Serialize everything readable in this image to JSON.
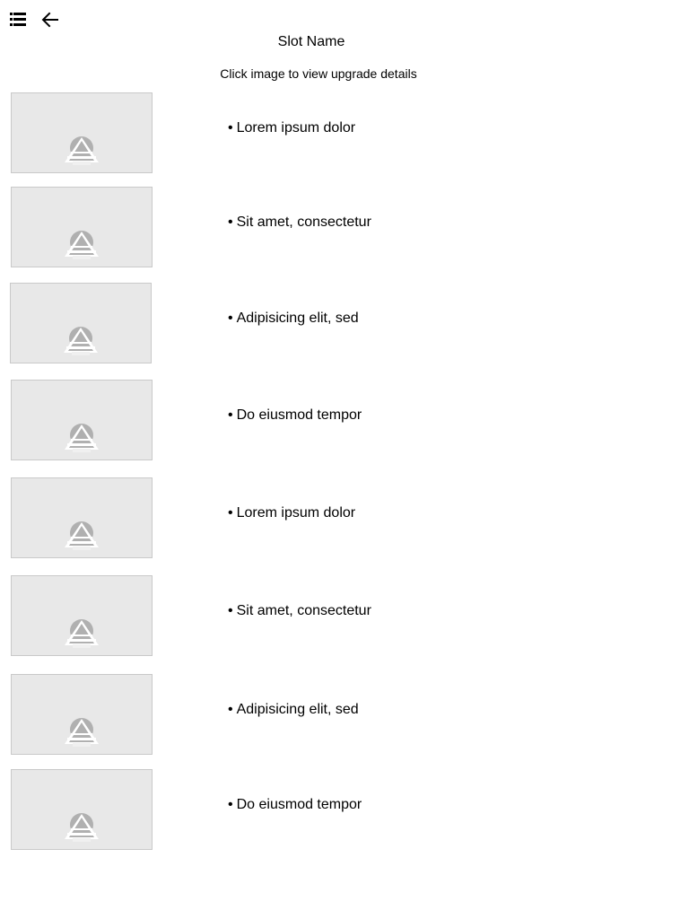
{
  "header": {
    "menu_icon": "list-menu-icon",
    "back_icon": "arrow-left-icon",
    "title": "Slot Name",
    "subtitle": "Click image to view upgrade details"
  },
  "bullet": "•",
  "items": [
    {
      "label": "Lorem ipsum dolor",
      "image_icon": "image-placeholder-icon"
    },
    {
      "label": "Sit amet, consectetur",
      "image_icon": "image-placeholder-icon"
    },
    {
      "label": "Adipisicing elit, sed",
      "image_icon": "image-placeholder-icon"
    },
    {
      "label": "Do eiusmod tempor",
      "image_icon": "image-placeholder-icon"
    },
    {
      "label": "Lorem ipsum dolor",
      "image_icon": "image-placeholder-icon"
    },
    {
      "label": "Sit amet, consectetur",
      "image_icon": "image-placeholder-icon"
    },
    {
      "label": "Adipisicing elit, sed",
      "image_icon": "image-placeholder-icon"
    },
    {
      "label": "Do eiusmod tempor",
      "image_icon": "image-placeholder-icon"
    }
  ],
  "colors": {
    "thumb_bg": "#e8e8e8",
    "thumb_border": "#c9c9c9",
    "placeholder_gray": "#b0b0b0"
  }
}
